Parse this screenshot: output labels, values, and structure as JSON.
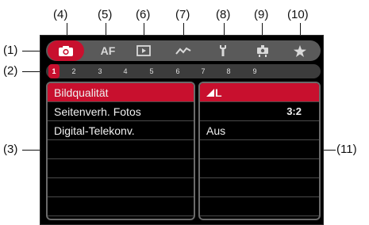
{
  "callouts": {
    "c4": "(4)",
    "c5": "(5)",
    "c6": "(6)",
    "c7": "(7)",
    "c8": "(8)",
    "c9": "(9)",
    "c10": "(10)",
    "c1": "(1)",
    "c2": "(2)",
    "c3": "(3)",
    "c11": "(11)"
  },
  "tabs": {
    "af_label": "AF"
  },
  "pages": [
    "1",
    "2",
    "3",
    "4",
    "5",
    "6",
    "7",
    "8",
    "9"
  ],
  "menu": {
    "items": [
      "Bildqualität",
      "Seitenverh. Fotos",
      "Digital-Telekonv."
    ]
  },
  "settings": {
    "image_quality_label": "L",
    "aspect_ratio": "3:2",
    "digital_teleconverter": "Aus"
  },
  "colors": {
    "accent": "#c8102e",
    "tabbar": "#5a5a5a",
    "screen": "#000000"
  }
}
